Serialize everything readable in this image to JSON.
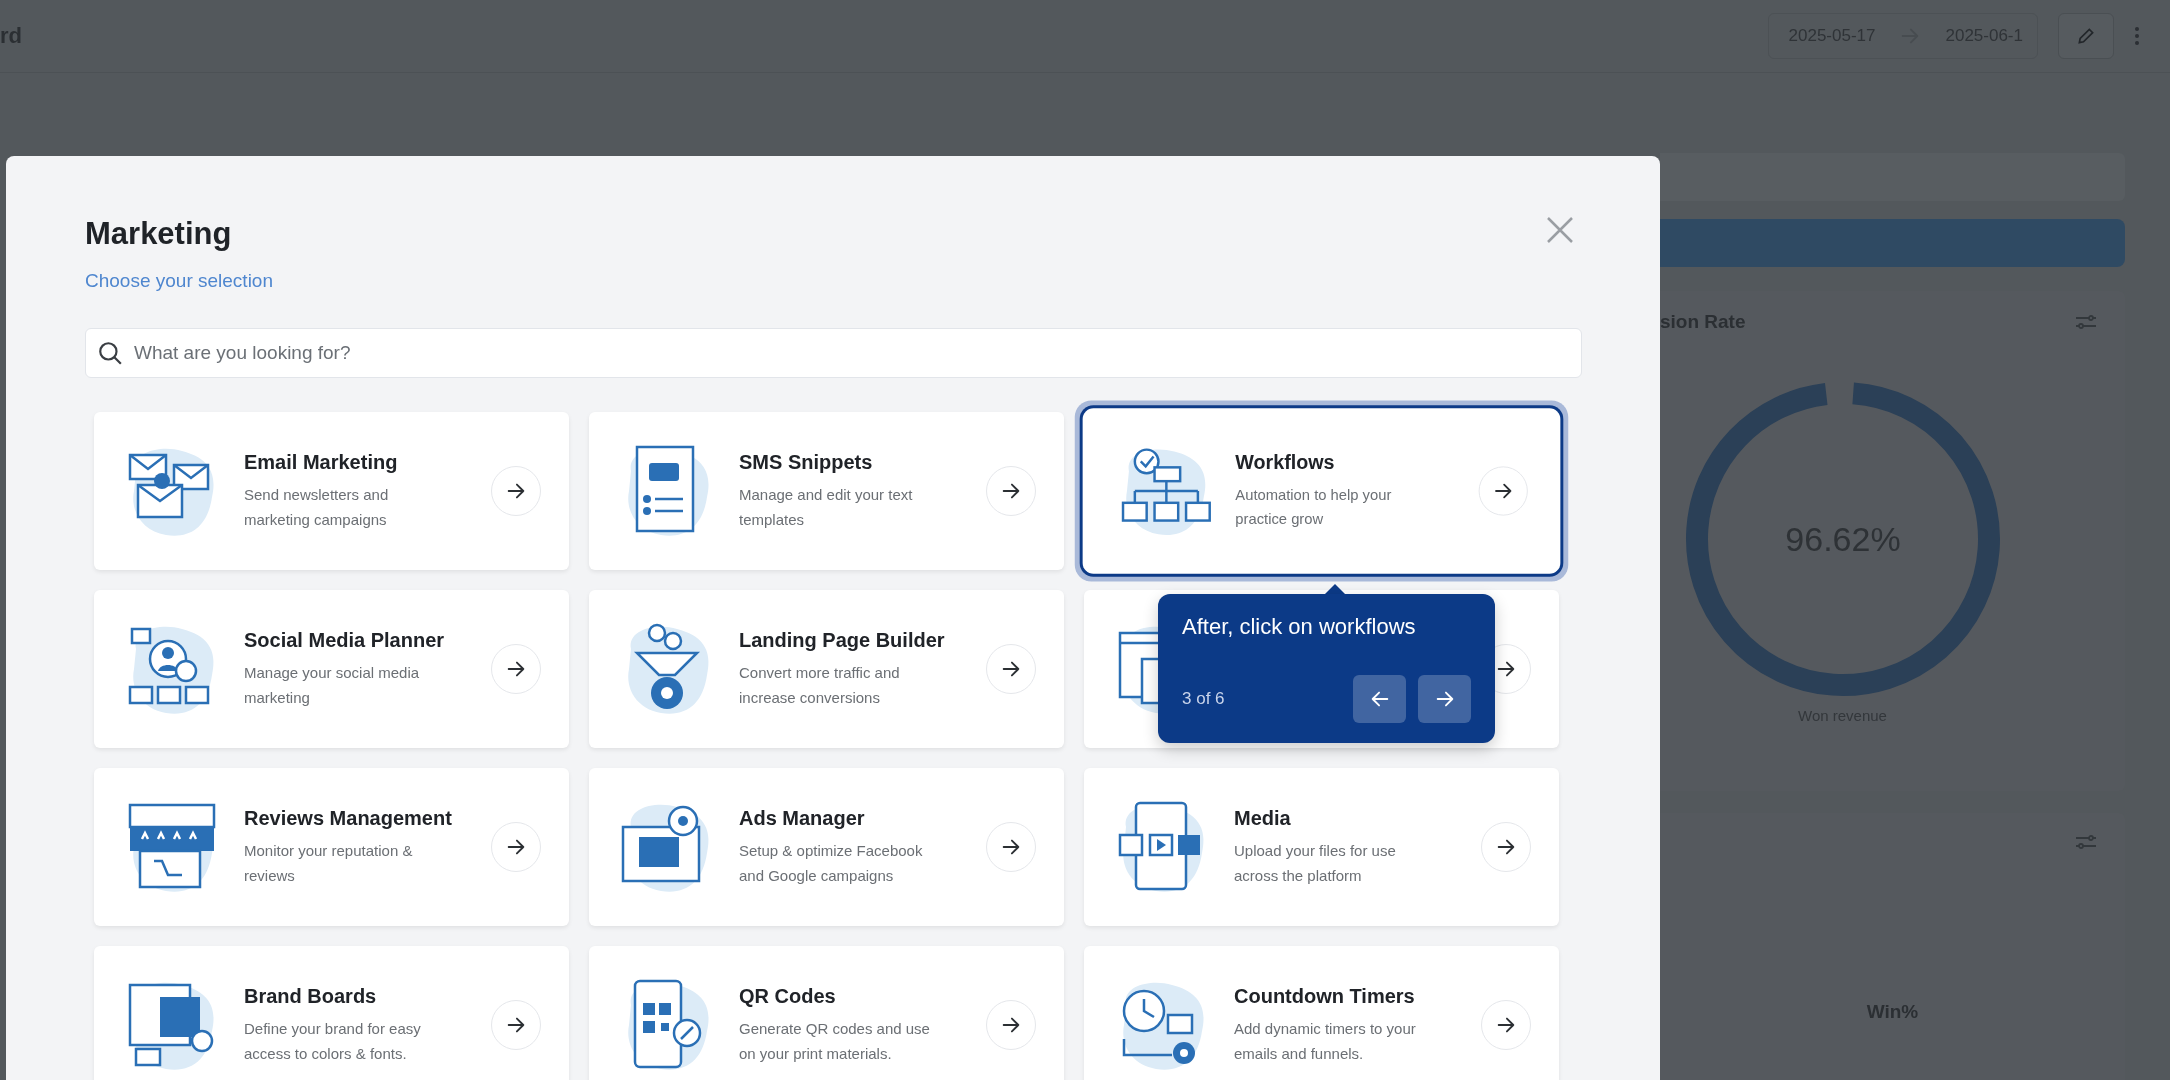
{
  "page": {
    "title": "rd",
    "date_from": "2025-05-17",
    "date_to": "2025-06-1"
  },
  "right_panel": {
    "card_title": "sion Rate",
    "donut_value": "96.62%",
    "donut_caption": "Won revenue",
    "table_header": "Win%"
  },
  "modal": {
    "title": "Marketing",
    "subtitle": "Choose your selection",
    "search": {
      "placeholder": "What are you looking for?"
    },
    "cards": [
      {
        "title": "Email Marketing",
        "description": "Send newsletters and marketing campaigns",
        "highlighted": false
      },
      {
        "title": "SMS Snippets",
        "description": "Manage and edit your text templates",
        "highlighted": false
      },
      {
        "title": "Workflows",
        "description": "Automation to help your practice grow",
        "highlighted": true
      },
      {
        "title": "Social Media Planner",
        "description": "Manage your social media marketing",
        "highlighted": false
      },
      {
        "title": "Landing Page Builder",
        "description": "Convert more traffic and increase conversions",
        "highlighted": false
      },
      {
        "highlighted": false
      },
      {
        "title": "Reviews Management",
        "description": "Monitor your reputation & reviews",
        "highlighted": false
      },
      {
        "title": "Ads Manager",
        "description": "Setup & optimize Facebook and Google campaigns",
        "highlighted": false
      },
      {
        "title": "Media",
        "description": "Upload your files for use across the platform",
        "highlighted": false
      },
      {
        "title": "Brand Boards",
        "description": "Define your brand for easy access to colors & fonts.",
        "highlighted": false
      },
      {
        "title": "QR Codes",
        "description": "Generate QR codes and use on your print materials.",
        "highlighted": false
      },
      {
        "title": "Countdown Timers",
        "description": "Add dynamic timers to your emails and funnels.",
        "highlighted": false
      }
    ]
  },
  "tour": {
    "text": "After, click on workflows",
    "step": "3 of 6"
  }
}
